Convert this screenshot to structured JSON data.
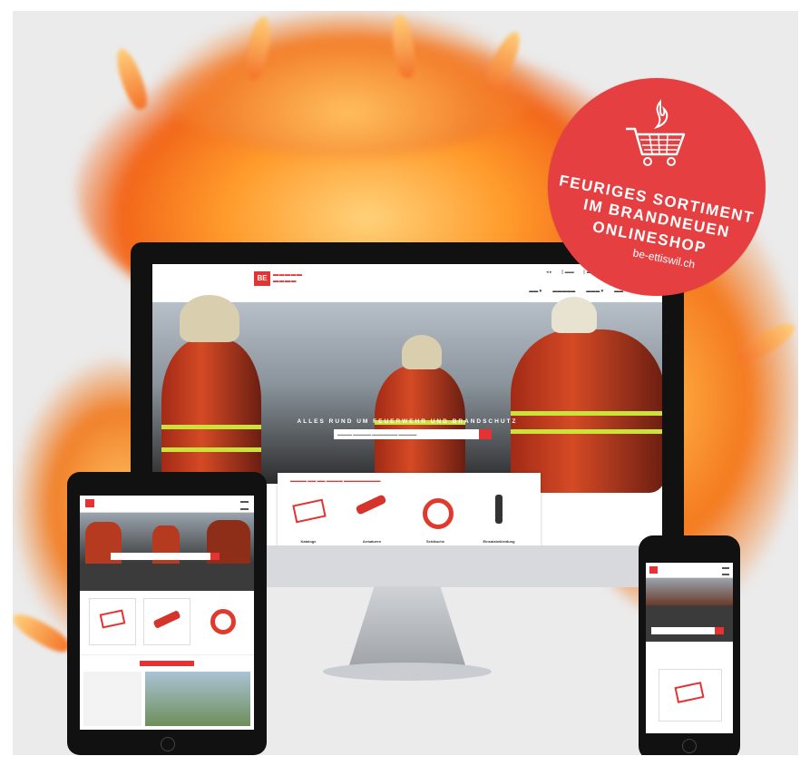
{
  "badge": {
    "line1": "FEURIGES SORTIMENT",
    "line2": "IM BRANDNEUEN",
    "line3": "ONLINESHOP",
    "url": "be-ettiswil.ch",
    "icon": "flaming-shopping-cart-icon"
  },
  "desktop": {
    "hero_title": "ALLES RUND UM FEUERWEHR UND BRANDSCHUTZ",
    "product_labels": [
      "Kataloge",
      "Armaturen",
      "Schläuche",
      "Einsatzbekleidung"
    ]
  },
  "colors": {
    "brand_red": "#e63232",
    "badge_red": "#e53f41",
    "fire_orange": "#f3802c"
  }
}
